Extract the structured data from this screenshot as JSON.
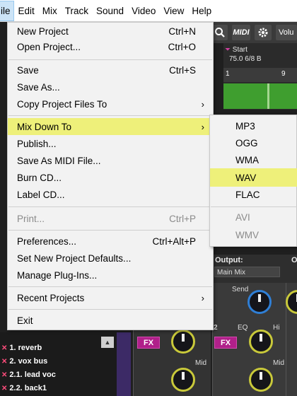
{
  "menubar": {
    "items": [
      "ile",
      "Edit",
      "Mix",
      "Track",
      "Sound",
      "Video",
      "View",
      "Help"
    ]
  },
  "toolbar": {
    "midi_label": "MIDI",
    "volume_label": "Volu"
  },
  "timeline": {
    "start_label": "Start",
    "tempo_meter": "75.0 6/8 B",
    "ruler_marks": [
      "1",
      "9"
    ]
  },
  "mixer": {
    "output_label": "Output:",
    "output_value": "Main Mix",
    "output_label_2": "O",
    "send_label": "Send",
    "eq_label": "EQ",
    "hi_label": "Hi",
    "mid_label": "Mid",
    "channel_num": "2",
    "fx_label": "FX"
  },
  "tracks": [
    {
      "label": "1. reverb"
    },
    {
      "label": "2. vox bus"
    },
    {
      "label": "2.1. lead voc"
    },
    {
      "label": "2.2. back1"
    }
  ],
  "file_menu": {
    "items": [
      {
        "label": "New Project",
        "shortcut": "Ctrl+N"
      },
      {
        "label": "Open Project...",
        "shortcut": "Ctrl+O"
      },
      {
        "label": "Save",
        "shortcut": "Ctrl+S"
      },
      {
        "label": "Save As...",
        "shortcut": ""
      },
      {
        "label": "Copy Project Files To",
        "shortcut": ""
      },
      {
        "label": "Mix Down To",
        "shortcut": ""
      },
      {
        "label": "Publish...",
        "shortcut": ""
      },
      {
        "label": "Save As MIDI File...",
        "shortcut": ""
      },
      {
        "label": "Burn CD...",
        "shortcut": ""
      },
      {
        "label": "Label CD...",
        "shortcut": ""
      },
      {
        "label": "Print...",
        "shortcut": "Ctrl+P"
      },
      {
        "label": "Preferences...",
        "shortcut": "Ctrl+Alt+P"
      },
      {
        "label": "Set New Project Defaults...",
        "shortcut": ""
      },
      {
        "label": "Manage Plug-Ins...",
        "shortcut": ""
      },
      {
        "label": "Recent Projects",
        "shortcut": ""
      },
      {
        "label": "Exit",
        "shortcut": ""
      }
    ],
    "submenu_arrow": "›"
  },
  "mixdown_submenu": {
    "items": [
      {
        "label": "MP3"
      },
      {
        "label": "OGG"
      },
      {
        "label": "WMA"
      },
      {
        "label": "WAV"
      },
      {
        "label": "FLAC"
      },
      {
        "label": "AVI"
      },
      {
        "label": "WMV"
      }
    ]
  },
  "colors": {
    "highlight": "#eef07a",
    "menu_bg": "#f2f2f2",
    "fx_button": "#b0208a",
    "clip_green": "#3f9e2f",
    "knob_yellow": "#c9c93a",
    "knob_blue": "#2f7fd6"
  },
  "icons": [
    "search-icon",
    "gear-icon",
    "close-icon",
    "chevron-right-icon",
    "chevron-up-icon"
  ]
}
